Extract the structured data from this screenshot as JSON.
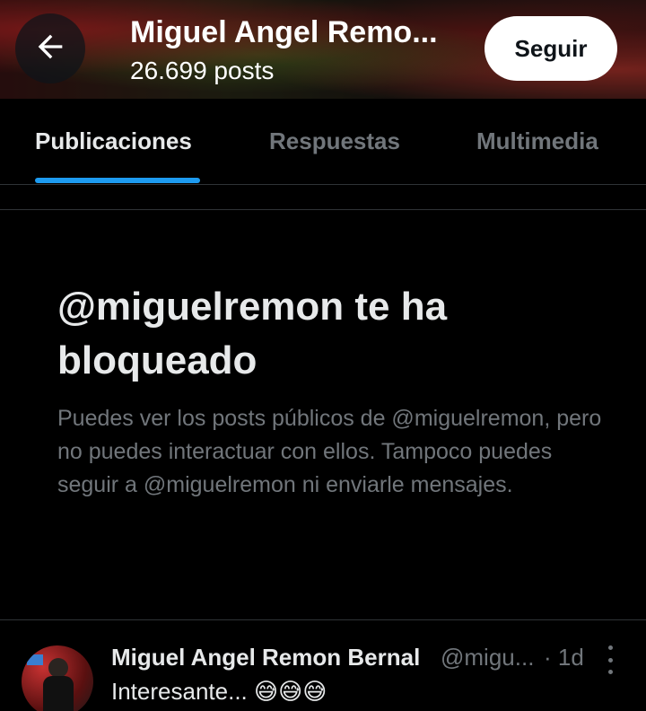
{
  "header": {
    "title": "Miguel Angel Remo...",
    "post_count": "26.699 posts",
    "follow_label": "Seguir",
    "back_icon": "arrow-left-icon"
  },
  "tabs": [
    {
      "label": "Publicaciones",
      "active": true
    },
    {
      "label": "Respuestas",
      "active": false
    },
    {
      "label": "Multimedia",
      "active": false
    }
  ],
  "blocked": {
    "title": "@miguelremon te ha bloqueado",
    "description": "Puedes ver los posts públicos de @miguelremon, pero no puedes interactuar con ellos. Tampoco puedes seguir a @miguelremon ni enviarle mensajes."
  },
  "post": {
    "name": "Miguel Angel Remon Bernal",
    "handle": "@migu...",
    "time": "· 1d",
    "text": "Interesante... 😅😅😅",
    "more_icon": "more-vertical-icon"
  },
  "colors": {
    "accent": "#1d9bf0",
    "background": "#000000",
    "muted_text": "#71767b",
    "primary_text": "#e7e9ea"
  }
}
